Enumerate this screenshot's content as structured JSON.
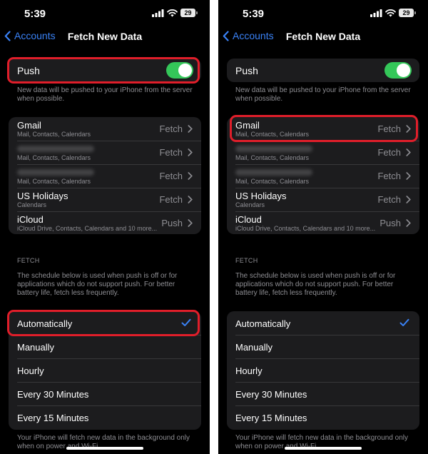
{
  "status_bar": {
    "time": "5:39",
    "battery": "29"
  },
  "nav": {
    "back_label": "Accounts",
    "title": "Fetch New Data"
  },
  "push": {
    "label": "Push",
    "enabled": true,
    "footnote": "New data will be pushed to your iPhone from the server when possible."
  },
  "accounts": [
    {
      "name": "Gmail",
      "detail": "Mail, Contacts, Calendars",
      "status": "Fetch"
    },
    {
      "name": "",
      "detail": "Mail, Contacts, Calendars",
      "status": "Fetch"
    },
    {
      "name": "",
      "detail": "Mail, Contacts, Calendars",
      "status": "Fetch"
    },
    {
      "name": "US Holidays",
      "detail": "Calendars",
      "status": "Fetch"
    },
    {
      "name": "iCloud",
      "detail": "iCloud Drive, Contacts, Calendars and 10 more...",
      "status": "Push"
    }
  ],
  "fetch": {
    "header": "FETCH",
    "footnote": "The schedule below is used when push is off or for applications which do not support push. For better battery life, fetch less frequently.",
    "options": [
      "Automatically",
      "Manually",
      "Hourly",
      "Every 30 Minutes",
      "Every 15 Minutes"
    ],
    "selected": "Automatically"
  },
  "bottom_footnote": "Your iPhone will fetch new data in the background only when on power and Wi-Fi.",
  "colors": {
    "accent": "#3a82f6",
    "toggle_on": "#34c759",
    "highlight": "#e01e2a",
    "cell_background": "#1c1c1e"
  }
}
